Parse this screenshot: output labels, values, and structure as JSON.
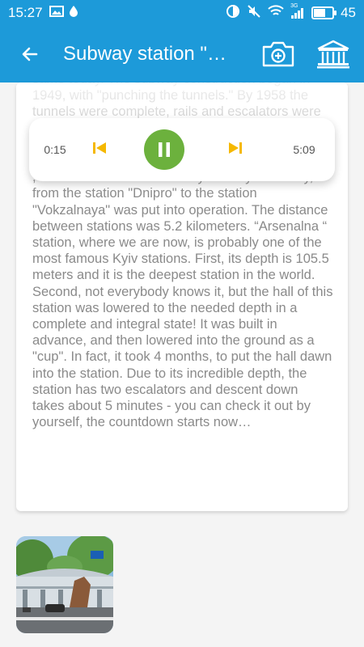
{
  "status": {
    "time": "15:27",
    "battery": "45",
    "signal_label": "3G"
  },
  "appbar": {
    "title": "Subway station \"…"
  },
  "article": {
    "paragraph": "same today. The subway construction began in 1949, with \"punching the tunnels.\" By 1958 the tunnels were complete, rails and escalators were installed, and then began the works with decoration works, and selected 80 best projects from the city contest. Finally, on 6 November 1960 , the first section of the newly built Kyiv subway, from the station \"Dnipro\" to the station \"Vokzalnaya\" was put into operation. The distance between stations was 5.2 kilometers. “Arsenalna “ station, where we are now, is probably one of the most famous Kyiv stations. First, its depth is 105.5 meters and it is the deepest station in the world. Second, not everybody knows it, but the hall of this station was lowered to the needed depth in a complete and integral state! It was built in advance, and then lowered into the ground as a \"cup\". In fact, it took 4 months, to put the hall dawn into the station. Due to its incredible depth, the station has two escalators and descent down takes about 5 minutes - you can check it out by yourself, the countdown starts now…"
  },
  "player": {
    "elapsed": "0:15",
    "total": "5:09",
    "state": "playing",
    "accent": "#6cb13d",
    "skip_color": "#f5b800"
  },
  "colors": {
    "primary": "#1d9ad9"
  }
}
